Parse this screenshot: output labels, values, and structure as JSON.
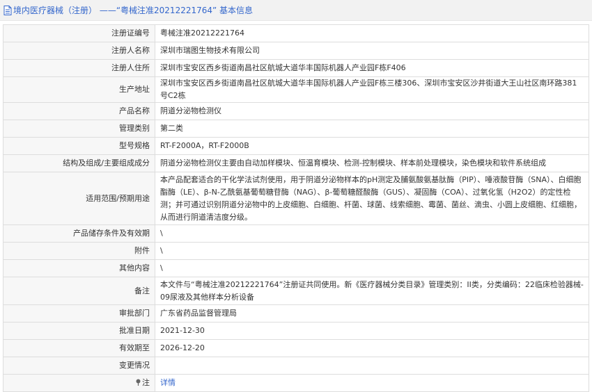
{
  "header": {
    "title": "境内医疗器械（注册） ——“粤械注准20212221764” 基本信息"
  },
  "rows": [
    {
      "label": "注册证编号",
      "value": "粤械注准20212221764"
    },
    {
      "label": "注册人名称",
      "value": "深圳市瑞图生物技术有限公司"
    },
    {
      "label": "注册人住所",
      "value": "深圳市宝安区西乡街道南昌社区航城大道华丰国际机器人产业园F栋F406"
    },
    {
      "label": "生产地址",
      "value": "深圳市宝安区西乡街道南昌社区航城大道华丰国际机器人产业园F栋三楼306、深圳市宝安区沙井街道大王山社区南环路381号C2栋"
    },
    {
      "label": "产品名称",
      "value": "阴道分泌物检测仪"
    },
    {
      "label": "管理类别",
      "value": "第二类"
    },
    {
      "label": "型号规格",
      "value": "RT-F2000A，RT-F2000B"
    },
    {
      "label": "结构及组成/主要组成成分",
      "value": "阴道分泌物检测仪主要由自动加样模块、恒温育模块、检测-控制模块、样本前处理模块，染色模块和软件系统组成"
    },
    {
      "label": "适用范围/预期用途",
      "value": "本产品配套适合的干化学法试剂使用，用于阴道分泌物样本的pH测定及脯氨酸氨基肽酶（PIP）、唾液酸苷酶（SNA）、白细胞酯酶（LE）、β-N-乙酰氨基葡萄糖苷酶（NAG）、β-葡萄糖醛酸酶（GUS）、凝固酶（COA）、过氧化氢（H2O2）的定性检测；并可通过识别阴道分泌物中的上皮细胞、白细胞、杆菌、球菌、线索细胞、霉菌、菌丝、滴虫、小圆上皮细胞、红细胞，从而进行阴道清洁度分级。"
    },
    {
      "label": "产品储存条件及有效期",
      "value": "\\"
    },
    {
      "label": "附件",
      "value": "\\"
    },
    {
      "label": "其他内容",
      "value": "\\"
    },
    {
      "label": "备注",
      "value": "本文件与“粤械注准20212221764”注册证共同使用。新《医疗器械分类目录》管理类别：II类，分类编码：22临床检验器械-09尿液及其他样本分析设备"
    },
    {
      "label": "审批部门",
      "value": "广东省药品监督管理局"
    },
    {
      "label": "批准日期",
      "value": "2021-12-30"
    },
    {
      "label": "有效期至",
      "value": "2026-12-20"
    },
    {
      "label": "变更情况",
      "value": ""
    }
  ],
  "note_row": {
    "label": "注",
    "link": "详情"
  }
}
